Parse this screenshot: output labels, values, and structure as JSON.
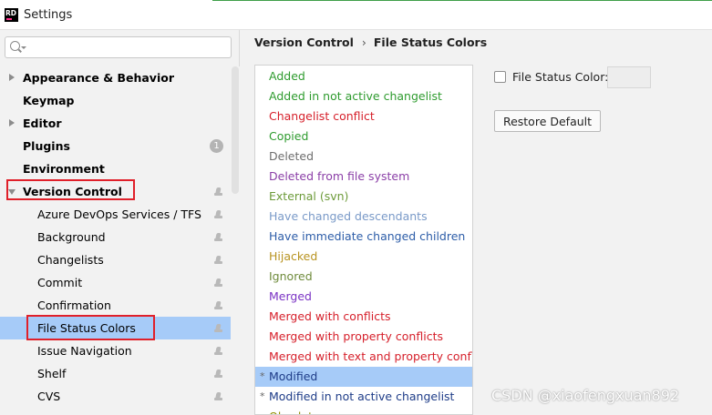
{
  "window": {
    "app_icon_text": "RD",
    "title": "Settings"
  },
  "search": {
    "placeholder": "",
    "value": ""
  },
  "sidebar": {
    "items": [
      {
        "label": "Appearance & Behavior"
      },
      {
        "label": "Keymap"
      },
      {
        "label": "Editor"
      },
      {
        "label": "Plugins",
        "badge": "1"
      },
      {
        "label": "Environment"
      },
      {
        "label": "Version Control"
      },
      {
        "label": "Azure DevOps Services / TFS"
      },
      {
        "label": "Background"
      },
      {
        "label": "Changelists"
      },
      {
        "label": "Commit"
      },
      {
        "label": "Confirmation"
      },
      {
        "label": "File Status Colors"
      },
      {
        "label": "Issue Navigation"
      },
      {
        "label": "Shelf"
      },
      {
        "label": "CVS"
      }
    ]
  },
  "breadcrumb": {
    "parent": "Version Control",
    "separator": "›",
    "current": "File Status Colors"
  },
  "statuses": [
    {
      "label": "Added",
      "color": "#2e9b2e"
    },
    {
      "label": "Added in not active changelist",
      "color": "#2e9b2e"
    },
    {
      "label": "Changelist conflict",
      "color": "#d6202b"
    },
    {
      "label": "Copied",
      "color": "#2e9b2e"
    },
    {
      "label": "Deleted",
      "color": "#6e6e6e"
    },
    {
      "label": "Deleted from file system",
      "color": "#8b3fa7"
    },
    {
      "label": "External (svn)",
      "color": "#6d9b3a"
    },
    {
      "label": "Have changed descendants",
      "color": "#7a9ac8"
    },
    {
      "label": "Have immediate changed children",
      "color": "#2d5da8"
    },
    {
      "label": "Hijacked",
      "color": "#b89320"
    },
    {
      "label": "Ignored",
      "color": "#6f8b3c"
    },
    {
      "label": "Merged",
      "color": "#7b33c4"
    },
    {
      "label": "Merged with conflicts",
      "color": "#d6202b"
    },
    {
      "label": "Merged with property conflicts",
      "color": "#d6202b"
    },
    {
      "label": "Merged with text and property confl...",
      "color": "#d6202b"
    },
    {
      "label": "Modified",
      "color": "#1e3c88",
      "marker": "*"
    },
    {
      "label": "Modified in not active changelist",
      "color": "#1e3c88",
      "marker": "*"
    },
    {
      "label": "Obsolete",
      "color": "#8f8f00"
    }
  ],
  "detail": {
    "color_label": "File Status Color:",
    "color_checked": false,
    "restore_label": "Restore Default"
  },
  "watermark": "CSDN @xiaofengxuan892",
  "colors": {
    "selection": "#a6cbf8",
    "highlight_box": "#e0202a"
  }
}
